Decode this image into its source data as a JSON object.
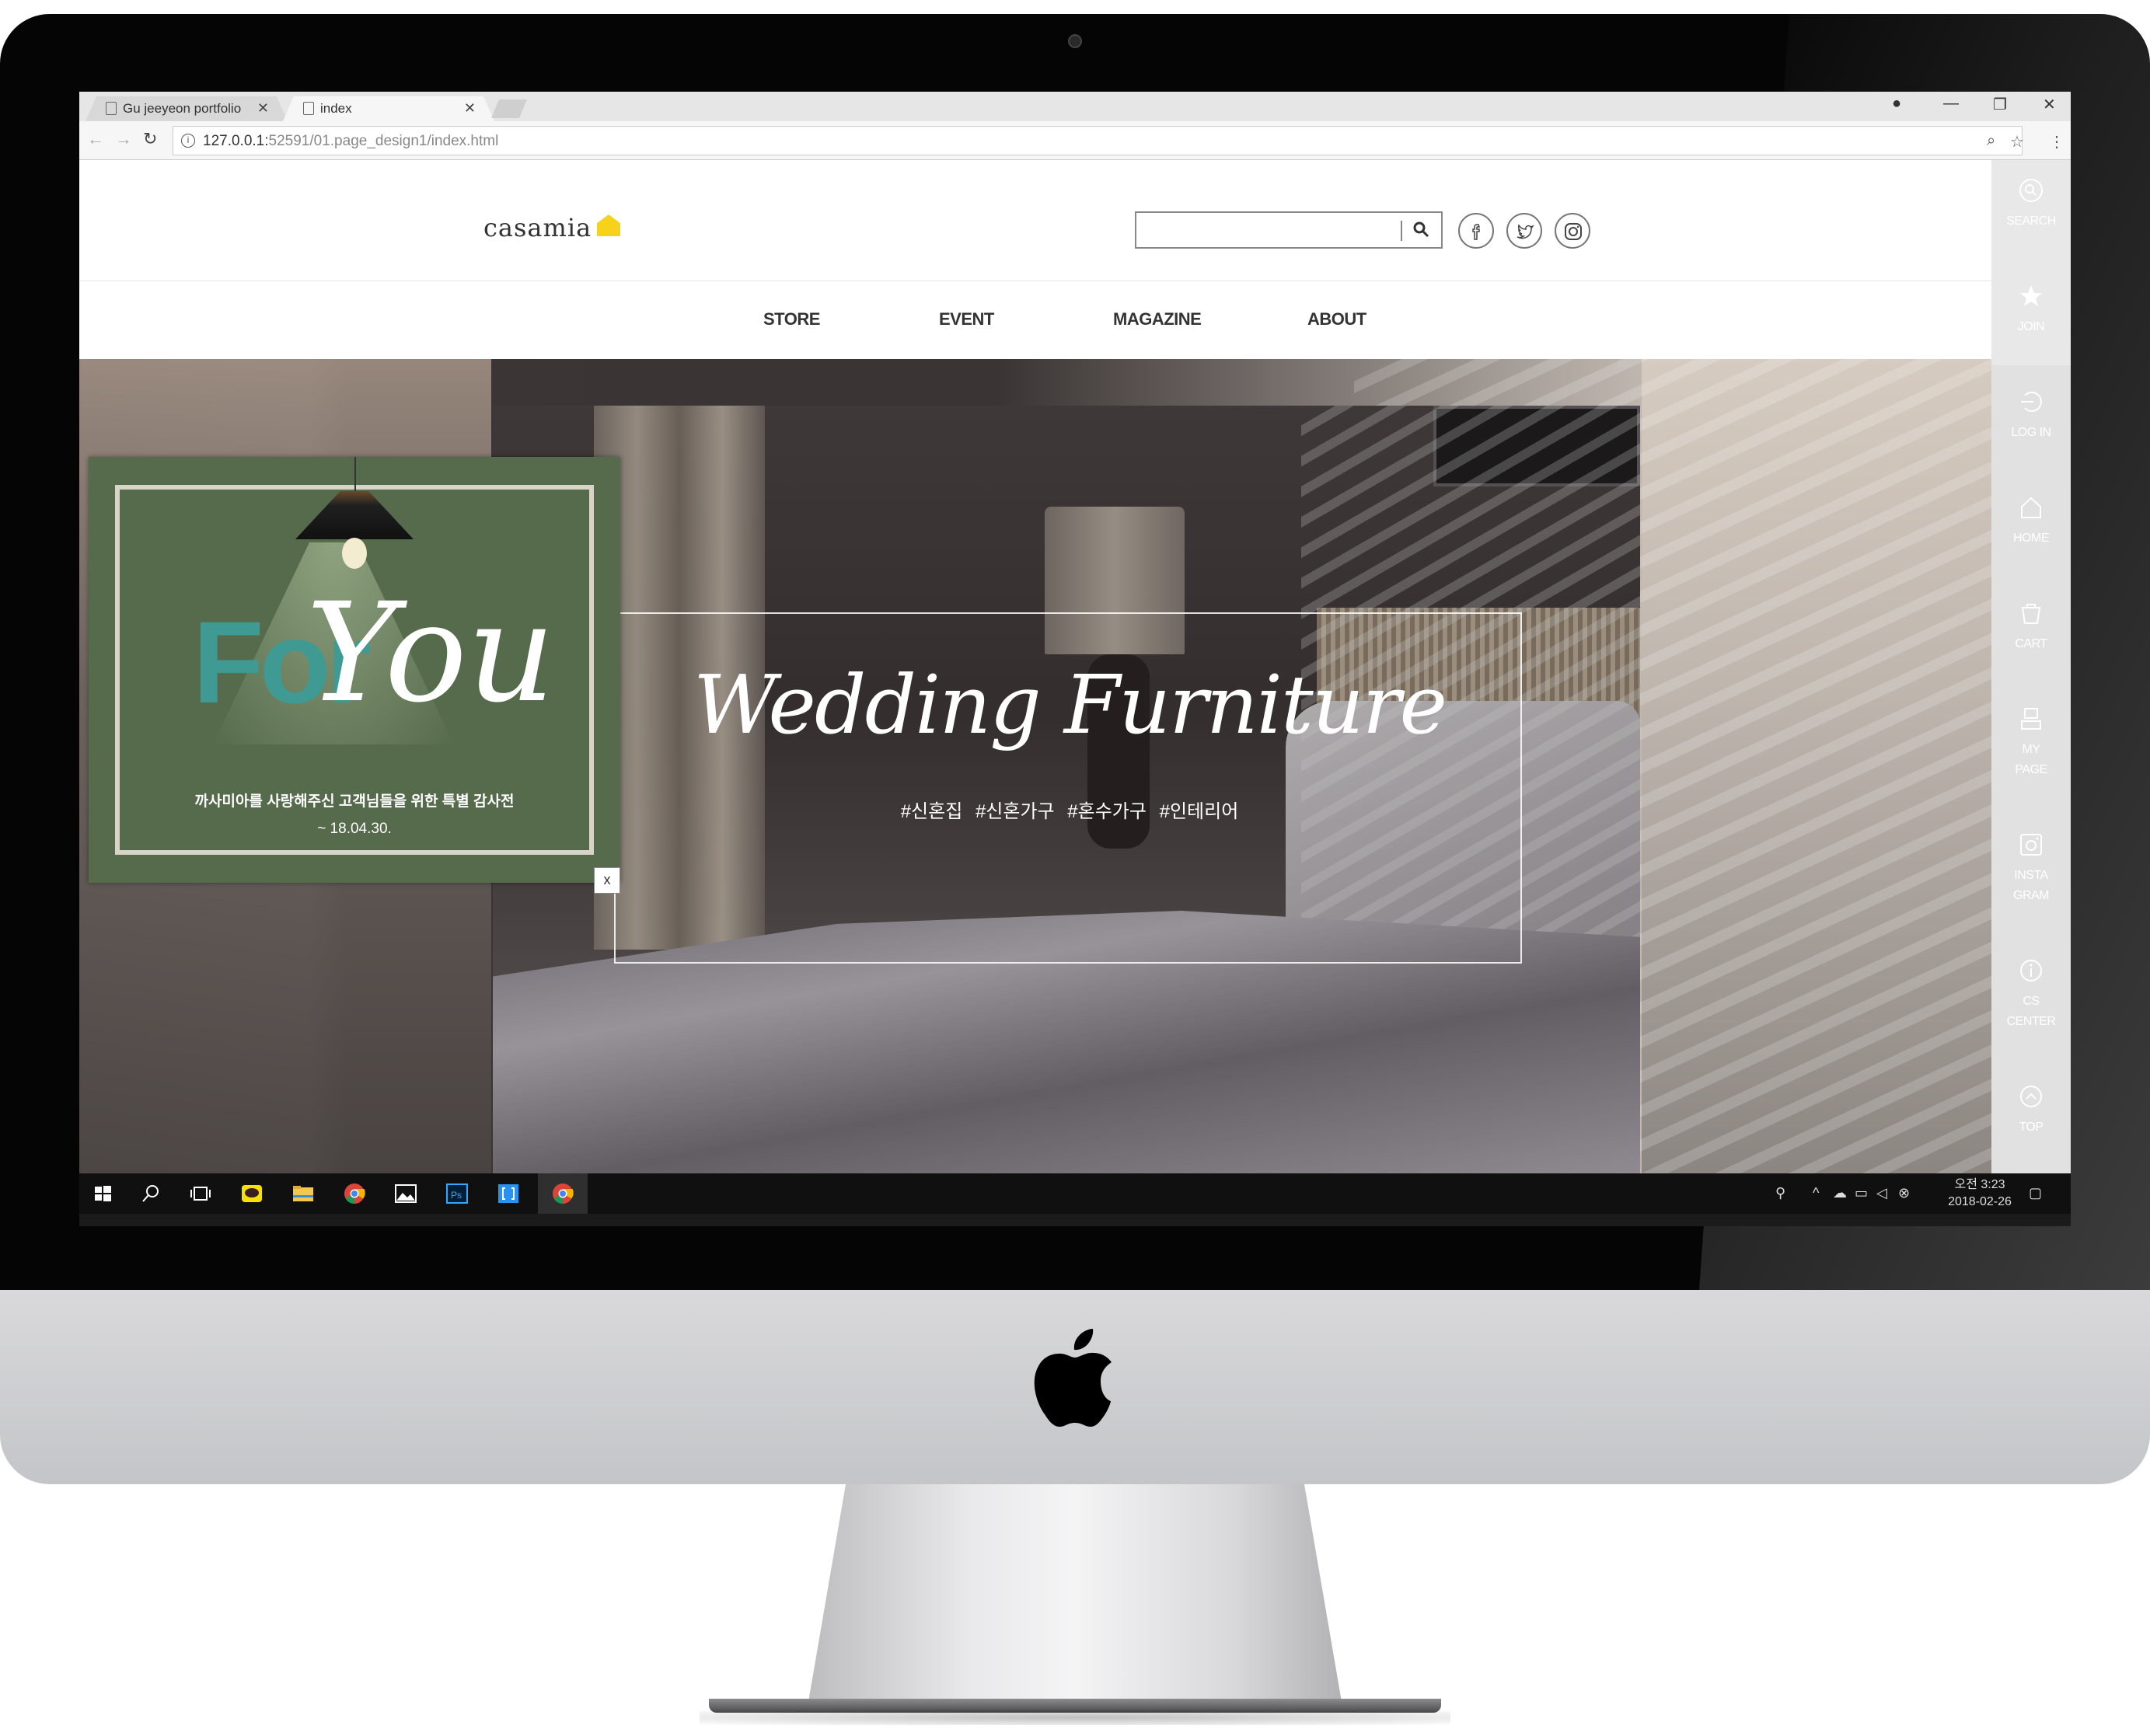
{
  "browser": {
    "tabs": [
      {
        "label": "Gu jeeyeon portfolio",
        "active": false
      },
      {
        "label": "index",
        "active": true
      }
    ],
    "url_host": "127.0.0.1:",
    "url_rest": "52591/01.page_design1/index.html",
    "window_controls": [
      "—",
      "❐",
      "✕"
    ]
  },
  "site": {
    "logo": "casamia",
    "search_placeholder": "",
    "social": [
      "facebook-icon",
      "twitter-icon",
      "instagram-icon"
    ],
    "nav": [
      "STORE",
      "EVENT",
      "MAGAZINE",
      "ABOUT"
    ]
  },
  "hero": {
    "title": "Wedding Furniture",
    "tags": "#신혼집  #신혼가구  #혼수가구  #인테리어"
  },
  "popup": {
    "for": "For",
    "you": "You",
    "text": "까사미아를 사랑해주신 고객님들을 위한 특별 감사전",
    "date": "~ 18.04.30.",
    "close": "x"
  },
  "sidebar": {
    "items": [
      {
        "label": "SEARCH",
        "icon": "search-icon"
      },
      {
        "label": "JOIN",
        "icon": "star-icon"
      },
      {
        "label": "LOG IN",
        "icon": "login-icon"
      },
      {
        "label": "HOME",
        "icon": "home-icon"
      },
      {
        "label": "CART",
        "icon": "cart-icon"
      },
      {
        "label": "MY",
        "label2": "PAGE",
        "icon": "mypage-icon"
      },
      {
        "label": "INSTA",
        "label2": "GRAM",
        "icon": "instagram-icon"
      },
      {
        "label": "CS",
        "label2": "CENTER",
        "icon": "info-icon"
      },
      {
        "label": "TOP",
        "icon": "top-icon"
      }
    ]
  },
  "taskbar": {
    "clock_time": "오전 3:23",
    "clock_date": "2018-02-26"
  },
  "colors": {
    "accent_yellow": "#f6d21a",
    "popup_green": "#566b4c",
    "popup_teal": "#3e9a92"
  }
}
